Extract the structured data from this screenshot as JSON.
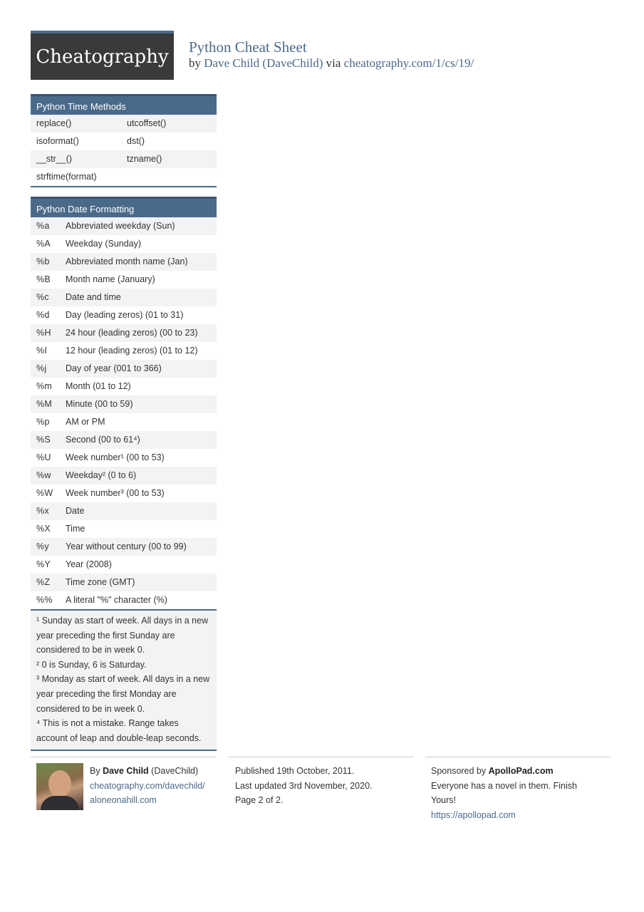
{
  "header": {
    "logo_text": "Cheatography",
    "title": "Python Cheat Sheet",
    "by": "by",
    "author_link": "Dave Child (DaveChild)",
    "via": "via",
    "url_link": "cheatography.com/1/cs/19/"
  },
  "time_methods": {
    "title": "Python Time Methods",
    "rows": [
      [
        "replace()",
        "utcoffset()"
      ],
      [
        "isoformat()",
        "dst()"
      ],
      [
        "__str__()",
        "tzname()"
      ],
      [
        "strftime(format)",
        ""
      ]
    ]
  },
  "date_formatting": {
    "title": "Python Date Formatting",
    "rows": [
      [
        "%a",
        "Abbreviated weekday (Sun)"
      ],
      [
        "%A",
        "Weekday (Sunday)"
      ],
      [
        "%b",
        "Abbreviated month name (Jan)"
      ],
      [
        "%B",
        "Month name (January)"
      ],
      [
        "%c",
        "Date and time"
      ],
      [
        "%d",
        "Day (leading zeros) (01 to 31)"
      ],
      [
        "%H",
        "24 hour (leading zeros) (00 to 23)"
      ],
      [
        "%I",
        "12 hour (leading zeros) (01 to 12)"
      ],
      [
        "%j",
        "Day of year (001 to 366)"
      ],
      [
        "%m",
        "Month (01 to 12)"
      ],
      [
        "%M",
        "Minute (00 to 59)"
      ],
      [
        "%p",
        "AM or PM"
      ],
      [
        "%S",
        "Second (00 to 61⁴)"
      ],
      [
        "%U",
        "Week number¹ (00 to 53)"
      ],
      [
        "%w",
        "Weekday² (0 to 6)"
      ],
      [
        "%W",
        "Week number³ (00 to 53)"
      ],
      [
        "%x",
        "Date"
      ],
      [
        "%X",
        "Time"
      ],
      [
        "%y",
        "Year without century (00 to 99)"
      ],
      [
        "%Y",
        "Year (2008)"
      ],
      [
        "%Z",
        "Time zone (GMT)"
      ],
      [
        "%%",
        "A literal \"%\" character (%)"
      ]
    ],
    "notes": [
      "¹ Sunday as start of week. All days in a new year preceding the first Sunday are considered to be in week 0.",
      "² 0 is Sunday, 6 is Saturday.",
      "³ Monday as start of week. All days in a new year preceding the first Monday are considered to be in week 0.",
      "⁴ This is not a mistake. Range takes account of leap and double-leap seconds."
    ]
  },
  "footer": {
    "author": {
      "by": "By",
      "name": "Dave Child",
      "handle": "(DaveChild)",
      "link1": "cheatography.com/davechild/",
      "link2": "aloneonahill.com"
    },
    "published": "Published 19th October, 2011.",
    "updated": "Last updated 3rd November, 2020.",
    "page": "Page 2 of 2.",
    "sponsor": {
      "label": "Sponsored by",
      "name": "ApolloPad.com",
      "text": "Everyone has a novel in them. Finish Yours!",
      "link": "https://apollopad.com"
    }
  },
  "colors": {
    "accent": "#4a6a8a",
    "logo_bg": "#3a3a3a",
    "row_alt": "#f2f3f5"
  }
}
